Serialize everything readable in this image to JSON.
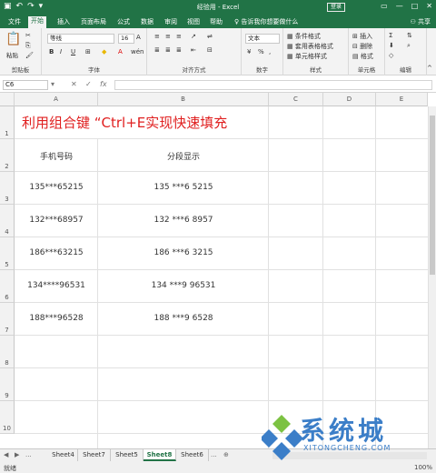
{
  "window": {
    "title": "经验用  -  Excel",
    "login": "登录"
  },
  "tabs": [
    "文件",
    "开始",
    "插入",
    "页面布局",
    "公式",
    "数据",
    "审阅",
    "视图",
    "帮助"
  ],
  "tell_me": "告诉我你想要做什么",
  "share": "共享",
  "ribbon": {
    "paste": "粘贴",
    "clipboard": "剪贴板",
    "font_name": "等线",
    "font_size": "16",
    "font_group": "字体",
    "align_group": "对齐方式",
    "number_format": "文本",
    "number_group": "数字",
    "cond_format": "条件格式",
    "table_format": "套用表格格式",
    "cell_style": "单元格样式",
    "style_group": "样式",
    "insert": "插入",
    "delete": "删除",
    "format": "格式",
    "cells_group": "单元格",
    "edit_group": "编辑"
  },
  "name_box": "C6",
  "formula": "",
  "columns": [
    "A",
    "B",
    "C",
    "D",
    "E"
  ],
  "rows": [
    "1",
    "2",
    "3",
    "4",
    "5",
    "6",
    "7",
    "8",
    "9",
    "10"
  ],
  "sheet": {
    "title": "利用组合键  “Ctrl+E实现快速填充",
    "headers": [
      "手机号码",
      "分段显示"
    ],
    "data": [
      [
        "135***65215",
        "135 ***6 5215"
      ],
      [
        "132***68957",
        "132 ***6 8957"
      ],
      [
        "186***63215",
        "186 ***6 3215"
      ],
      [
        "134****96531",
        "134 ***9 96531"
      ],
      [
        "188***96528",
        "188 ***9 6528"
      ]
    ]
  },
  "sheet_tabs": [
    "Sheet4",
    "Sheet7",
    "Sheet5",
    "Sheet8",
    "Sheet6"
  ],
  "active_sheet": "Sheet8",
  "status": {
    "ready": "就绪",
    "zoom": "100%"
  },
  "watermark": {
    "text": "系统城",
    "sub": "XITONGCHENG.COM"
  }
}
